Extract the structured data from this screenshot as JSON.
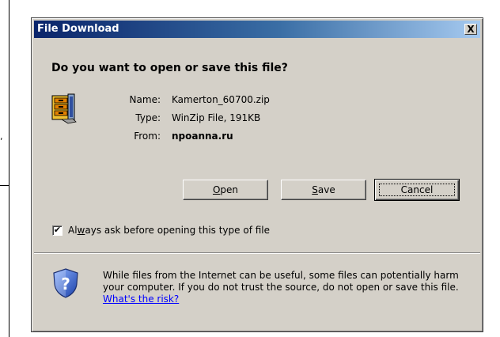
{
  "background": {
    "fragment": ","
  },
  "dialog": {
    "title": "File Download",
    "close_label": "X",
    "question": "Do you want to open or save this file?",
    "file_icon": "winzip-file-icon",
    "info": {
      "name_label": "Name:",
      "name_value": "Kamerton_60700.zip",
      "type_label": "Type:",
      "type_value": "WinZip File, 191KB",
      "from_label": "From:",
      "from_value": "npoanna.ru"
    },
    "buttons": {
      "open": {
        "mnemonic": "O",
        "rest": "pen"
      },
      "save": {
        "mnemonic": "S",
        "rest": "ave"
      },
      "cancel": "Cancel"
    },
    "checkbox": {
      "checked": true,
      "label_pre": "Al",
      "label_mnemonic": "w",
      "label_post": "ays ask before opening this type of file"
    },
    "warning": {
      "icon": "shield-question-icon",
      "text": "While files from the Internet can be useful, some files can potentially harm your computer. If you do not trust the source, do not open or save this file.",
      "link": "What's the risk?"
    }
  }
}
